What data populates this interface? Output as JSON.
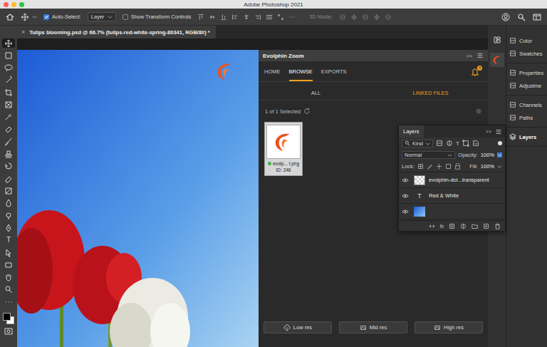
{
  "window": {
    "title": "Adobe Photoshop 2021"
  },
  "options_bar": {
    "auto_select": {
      "label": "Auto-Select:",
      "checked": true
    },
    "target": "Layer",
    "transform_controls": {
      "label": "Show Transform Controls",
      "checked": false
    },
    "mode_3d": "3D Mode:"
  },
  "toolbar": {
    "tools": [
      {
        "kind": "icon",
        "selected": true
      },
      {
        "kind": "icon",
        "selected": false
      },
      {
        "kind": "icon",
        "selected": false
      },
      {
        "kind": "icon",
        "selected": false
      },
      {
        "kind": "icon",
        "selected": false
      },
      {
        "kind": "icon",
        "selected": false
      },
      {
        "kind": "icon",
        "selected": false
      },
      {
        "kind": "icon",
        "selected": false
      },
      {
        "kind": "icon",
        "selected": false
      },
      {
        "kind": "icon",
        "selected": false
      },
      {
        "kind": "icon",
        "selected": false
      },
      {
        "kind": "icon",
        "selected": false
      },
      {
        "kind": "icon",
        "selected": false
      },
      {
        "kind": "icon",
        "selected": false
      },
      {
        "kind": "icon",
        "selected": false
      },
      {
        "kind": "icon",
        "selected": false
      },
      {
        "kind": "glyph",
        "glyph": "T",
        "selected": false
      },
      {
        "kind": "icon",
        "selected": false
      },
      {
        "kind": "icon",
        "selected": false
      },
      {
        "kind": "icon",
        "selected": false
      },
      {
        "kind": "icon",
        "selected": false
      },
      {
        "kind": "icon",
        "selected": false
      }
    ]
  },
  "document_tab": {
    "title": "Tulips blooming.psd @ 66.7% (tulips-red-white-spring-80341, RGB/8#) *",
    "close": "×"
  },
  "plugin_panel": {
    "title": "Evolphin Zoom",
    "collapse": ">>",
    "tabs": [
      {
        "label": "HOME",
        "selected": false
      },
      {
        "label": "BROWSE",
        "selected": true
      },
      {
        "label": "EXPORTS",
        "selected": false
      }
    ],
    "notification_count": "4",
    "filters": [
      {
        "label": "ALL",
        "selected": false
      },
      {
        "label": "LINKED FILES",
        "selected": true
      }
    ],
    "selection_status": "1 of 1 Selected",
    "assets": [
      {
        "name": "evolp... t.png",
        "id": "ID: 246",
        "selected": true,
        "color": "#3bb54a"
      }
    ],
    "buttons": [
      "Low res",
      "Mid res",
      "High res"
    ]
  },
  "dock": {
    "groups": [
      [
        {
          "label": "Color",
          "selected": false
        },
        {
          "label": "Swatches",
          "selected": false
        }
      ],
      [
        {
          "label": "Properties",
          "selected": false
        },
        {
          "label": "Adjustme",
          "selected": false
        }
      ],
      [
        {
          "label": "Channels",
          "selected": false
        },
        {
          "label": "Paths",
          "selected": false
        }
      ],
      [
        {
          "label": "Layers",
          "selected": true
        }
      ]
    ]
  },
  "layers_panel": {
    "title": "Layers",
    "collapse": ">>",
    "filter": "Kind",
    "type_filter_glyph": "T",
    "blend_mode": "Normal",
    "opacity_label": "Opacity:",
    "opacity": "100%",
    "lock_label": "Lock:",
    "fill_label": "Fill:",
    "fill": "100%",
    "footer_glyph": "fx",
    "layers": [
      {
        "name": "evolphin-dol...transparent",
        "kind": "image",
        "visible": true
      },
      {
        "name": "Red & White",
        "kind": "text",
        "glyph": "T",
        "visible": true
      },
      {
        "kind": "photo",
        "visible": true
      }
    ]
  }
}
